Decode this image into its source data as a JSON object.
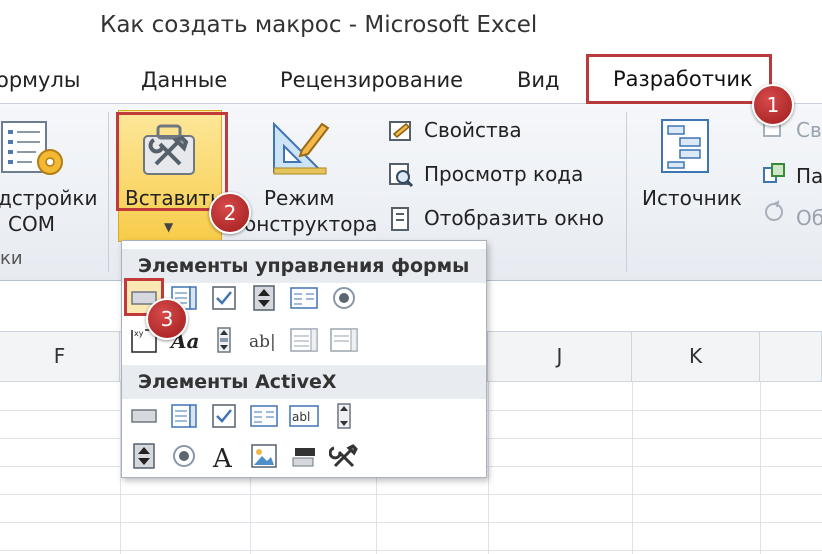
{
  "window": {
    "title": "Как создать макрос  -  Microsoft Excel"
  },
  "tabs": [
    {
      "label": "ормулы"
    },
    {
      "label": "Данные"
    },
    {
      "label": "Рецензирование"
    },
    {
      "label": "Вид"
    },
    {
      "label": "Разработчик"
    }
  ],
  "ribbon": {
    "addins_label_1": "дстройки",
    "addins_label_2": "COM",
    "addins_group": "ки",
    "insert_label": "Вставить",
    "design_label_1": "Режим",
    "design_label_2": "онструктора",
    "properties": "Свойства",
    "view_code": "Просмотр кода",
    "show_window": "Отобразить окно",
    "source_label": "Источник",
    "right_1": "Св",
    "right_2": "Па",
    "right_3": "Об"
  },
  "dropdown": {
    "form_controls_header": "Элементы управления формы",
    "activex_header": "Элементы ActiveX"
  },
  "badges": [
    "1",
    "2",
    "3"
  ],
  "columns": [
    "F",
    "J",
    "K"
  ],
  "colors": {
    "badge": "#b8282a",
    "highlight_border": "#c0393b",
    "insert_button": "#f7cc4a"
  }
}
